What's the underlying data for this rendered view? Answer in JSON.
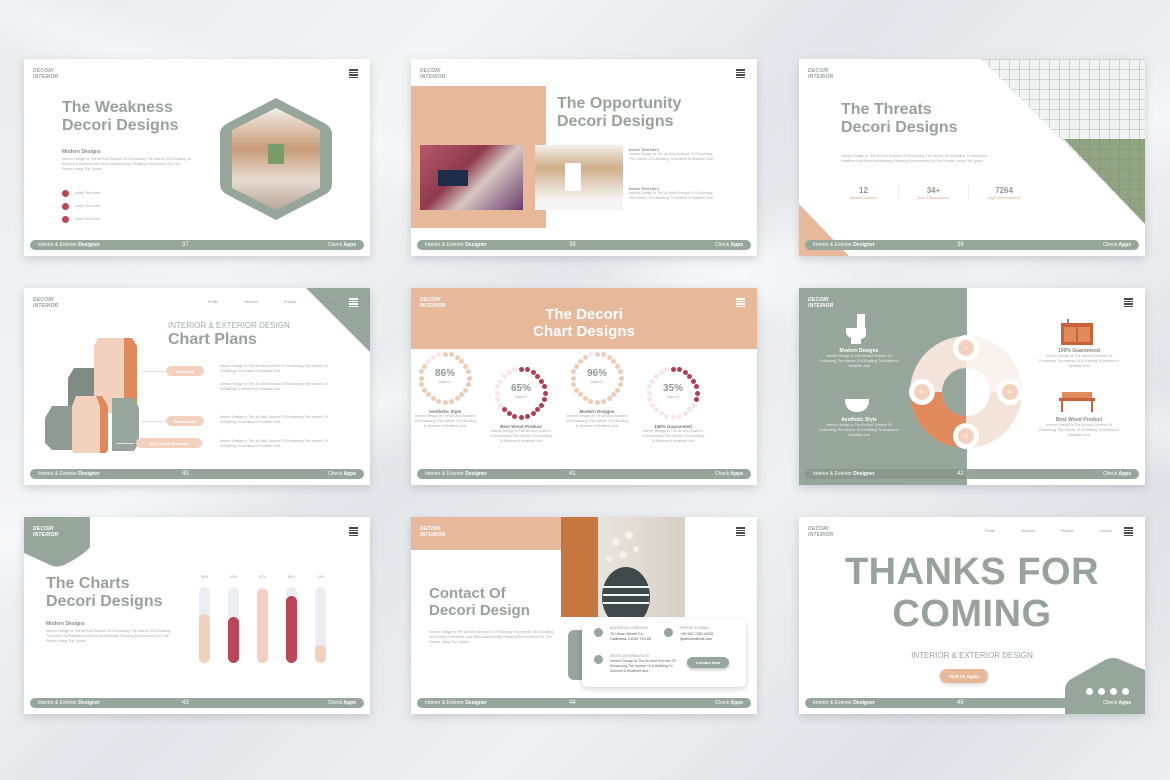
{
  "common": {
    "logo_line1": "DECORI",
    "logo_line2": "INTERIOR",
    "footer_left": "Interior & Exterior ",
    "footer_left_bold": "Designer",
    "footer_right": "Check ",
    "footer_right_bold": "Apps",
    "nav": [
      "Profile",
      "Services",
      "Product",
      "Contact"
    ]
  },
  "colors": {
    "sage": "#97a69b",
    "peach": "#e8b89a",
    "orange": "#e0895a",
    "crimson": "#bd4558"
  },
  "slides": [
    {
      "page": "37",
      "title1": "The Weakness",
      "title2": "Decori Designs",
      "subhead": "Modern Designs",
      "body": "Interior Design Is The Art And Science Of Enhancing The Interior Of A Building To Achieve A Healthier And More Aesthetically Pleasing Environment For The People Using The Space.",
      "bullets": [
        "Insert Text Here",
        "Insert Text Here",
        "Insert Text Here"
      ]
    },
    {
      "page": "38",
      "title1": "The Opportunity",
      "title2": "Decori Designs",
      "items": [
        {
          "head": "Insert Text Here",
          "body": "Interior Design Is The Art And Science Of Enhancing The Interior Of A Building To Achieve A Healthier And"
        },
        {
          "head": "Insert Text Here",
          "body": "Interior Design Is The Art And Science Of Enhancing The Interior Of A Building To Achieve A Healthier And"
        }
      ]
    },
    {
      "page": "39",
      "title1": "The Threats",
      "title2": "Decori Designs",
      "body": "Interior Design Is The Art And Science Of Enhancing The Interior Of A Building To Achieve A Healthier And More Aesthetically Pleasing Environment For The People Using The Space.",
      "stats": [
        {
          "value": "12",
          "label": "Awards Interior"
        },
        {
          "value": "34+",
          "label": "Best Nominations"
        },
        {
          "value": "7264",
          "label": "High Achievement"
        }
      ]
    },
    {
      "page": "40",
      "kicker": "INTERIOR & EXTERIOR DESIGN",
      "title": "Chart Plans",
      "pills": [
        "Furniture",
        "Guaranteed",
        "High Wood Products"
      ],
      "desc": "Interior Design Is The Art And Science Of Enhancing The Interior Of A Building To Achieve A Healthier And"
    },
    {
      "page": "41",
      "title1": "The Decori",
      "title2": "Chart Designs",
      "charts": [
        {
          "value": "86%",
          "label": "Data 01",
          "pct": 86,
          "color": "#eccdb9",
          "title": "Aesthetic Style"
        },
        {
          "value": "65%",
          "label": "Data 02",
          "pct": 65,
          "color": "#b23e55",
          "title": "Best Wood Product"
        },
        {
          "value": "96%",
          "label": "Data 03",
          "pct": 96,
          "color": "#eccdb9",
          "title": "Modern Designs"
        },
        {
          "value": "35%",
          "label": "Data 04",
          "pct": 35,
          "color": "#b23e55",
          "title": "100% Guaranteed"
        }
      ],
      "desc": "Interior Design Is The Art And Science Of Enhancing The Interior Of A Building To Achieve A Healthier And"
    },
    {
      "page": "42",
      "left": [
        {
          "title": "Modern Designs"
        },
        {
          "title": "Aesthetic Style"
        }
      ],
      "right": [
        {
          "title": "100% Guaranteed"
        },
        {
          "title": "Best Wood Product"
        }
      ],
      "desc": "Interior Design Is The Art And Science Of Enhancing The Interior Of A Building To Achieve A Healthier And",
      "nodes": [
        "01",
        "02",
        "03",
        "04"
      ]
    },
    {
      "page": "43",
      "title1": "The Charts",
      "title2": "Decori Designs",
      "subhead": "Modern Designs",
      "body": "Interior Design Is The Art And Science Of Enhancing The Interior Of A Building To Achieve A Healthier And More Aesthetically Pleasing Environment For The People Using The Space.",
      "bars": [
        {
          "label": "65%",
          "pct": 65,
          "color": "#f2d2bf"
        },
        {
          "label": "60%",
          "pct": 60,
          "color": "#bd4558"
        },
        {
          "label": "97%",
          "pct": 97,
          "color": "#f2d2bf"
        },
        {
          "label": "88%",
          "pct": 88,
          "color": "#bd4558"
        },
        {
          "label": "24%",
          "pct": 24,
          "color": "#f2d2bf"
        }
      ]
    },
    {
      "page": "44",
      "title1": "Contact Of",
      "title2": "Decori Design",
      "body": "Interior Design Is The Art And Science Of Enhancing The Interior Of A Building To Achieve A Healthier And More Aesthetically Pleasing Environment For The People Using The Space.",
      "address_head": "ADDRESS COMPANY",
      "address_1": "76 Urban Street Co,",
      "address_2": "California, CA 82 710 83",
      "phone_head": "PHONE & EMAIL",
      "phone": "+65 567 7281 8343",
      "email": "@decorioffcial.com",
      "info_head": "MORE INFORMATION",
      "info_body": "Interior Design Is The Art And Science Of Enhancing The Interior Of A Building To Achieve A Healthier And",
      "contact_button": "Contact Now"
    },
    {
      "page": "45",
      "line1": "THANKS FOR",
      "line2": "COMING",
      "sub": "INTERIOR & EXTERIOR DESIGN",
      "button": "Visit Us Again"
    }
  ]
}
